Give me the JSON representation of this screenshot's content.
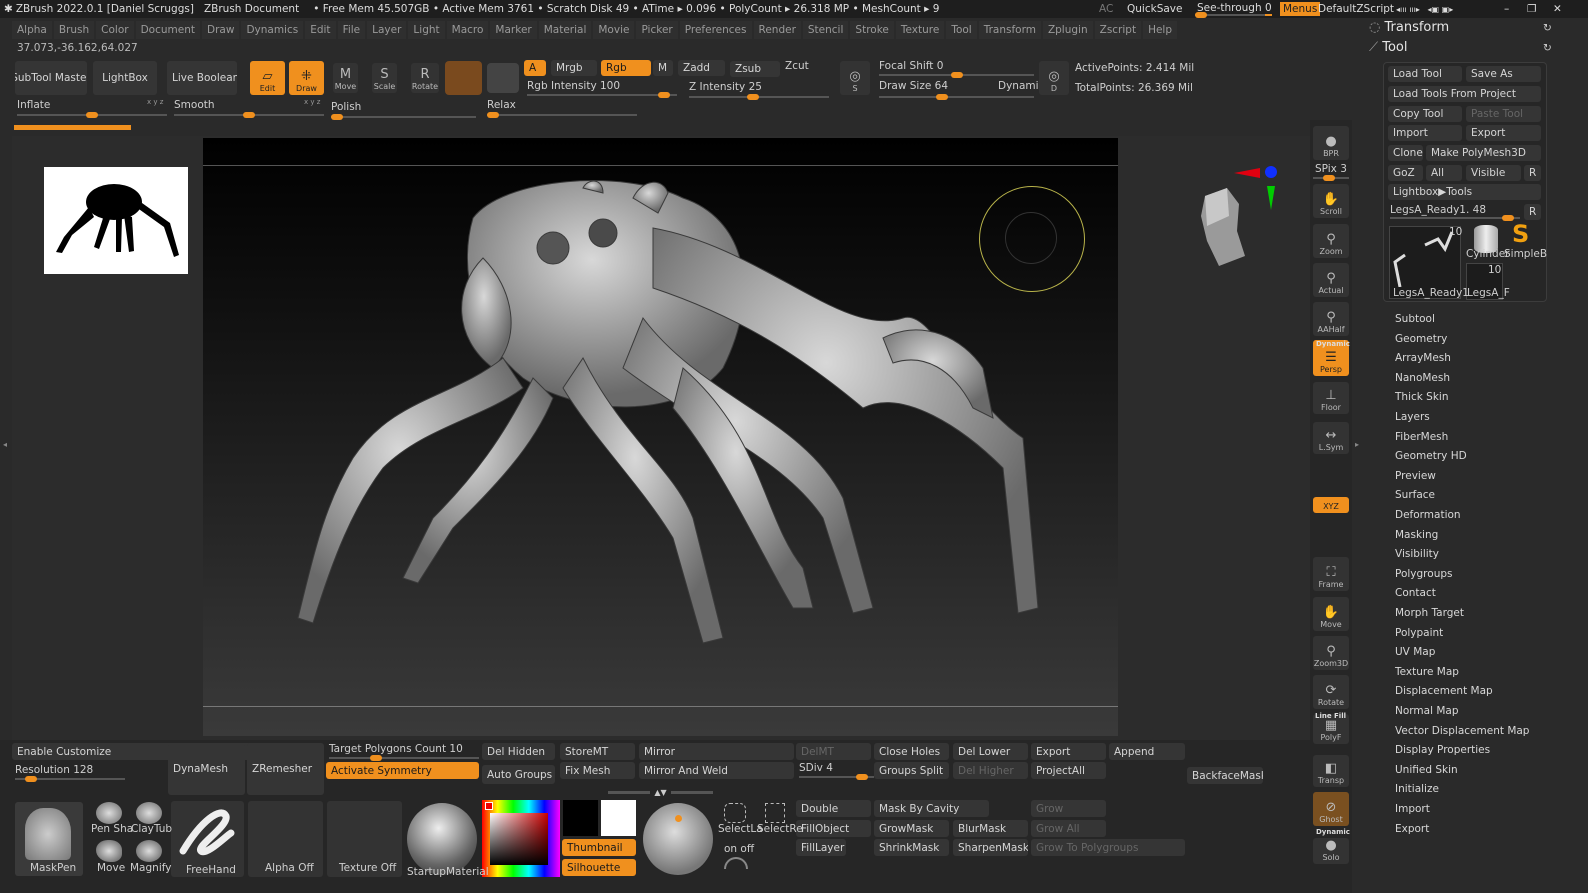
{
  "title": {
    "app": "ZBrush 2022.0.1 [Daniel Scruggs]",
    "doc": "ZBrush Document",
    "stats": "• Free Mem 45.507GB • Active Mem 3761 • Scratch Disk 49 • ATime ▸ 0.096 • PolyCount ▸ 26.318 MP • MeshCount ▸ 9",
    "ac": "AC",
    "quicksave": "QuickSave",
    "seethrough": "See-through  0",
    "menus": "Menus",
    "script": "DefaultZScript"
  },
  "menu": [
    "Alpha",
    "Brush",
    "Color",
    "Document",
    "Draw",
    "Dynamics",
    "Edit",
    "File",
    "Layer",
    "Light",
    "Macro",
    "Marker",
    "Material",
    "Movie",
    "Picker",
    "Preferences",
    "Render",
    "Stencil",
    "Stroke",
    "Texture",
    "Tool",
    "Transform",
    "Zplugin",
    "Zscript",
    "Help"
  ],
  "coords": "37.073,-36.162,64.027",
  "toolbar": {
    "subtool_master": "SubTool Master",
    "lightbox": "LightBox",
    "live_boolean": "Live Boolean",
    "edit": "Edit",
    "draw": "Draw",
    "move": "Move",
    "scale": "Scale",
    "rotate": "Rotate",
    "a": "A",
    "mrgb": "Mrgb",
    "rgb": "Rgb",
    "m": "M",
    "zadd": "Zadd",
    "zsub": "Zsub",
    "zcut": "Zcut",
    "rgb_intensity": "Rgb Intensity 100",
    "z_intensity": "Z Intensity 25",
    "focal_shift": "Focal Shift 0",
    "draw_size": "Draw Size 64",
    "dynamic": "Dynamic",
    "active_points": "ActivePoints: 2.414 Mil",
    "total_points": "TotalPoints: 26.369 Mil",
    "s": "S",
    "d": "D"
  },
  "sliders": {
    "inflate": "Inflate",
    "smooth": "Smooth",
    "polish": "Polish",
    "relax": "Relax",
    "xyz": "x y z"
  },
  "panel": {
    "transform": "Transform",
    "tool": "Tool",
    "load_tool": "Load Tool",
    "save_as": "Save As",
    "load_from_project": "Load Tools From Project",
    "copy_tool": "Copy Tool",
    "paste_tool": "Paste Tool",
    "import": "Import",
    "export": "Export",
    "clone": "Clone",
    "make_polymesh": "Make PolyMesh3D",
    "goz": "GoZ",
    "all": "All",
    "visible": "Visible",
    "r": "R",
    "lightbox_tools": "Lightbox▶Tools",
    "current_tool": "LegsA_Ready1. 48",
    "thumb1": "LegsA_Ready1",
    "thumb1_count": "10",
    "thumb2": "Cylinder",
    "thumb3": "SimpleB",
    "thumb4": "LegsA_F",
    "thumb4_count": "10"
  },
  "subpalettes": [
    "Subtool",
    "Geometry",
    "ArrayMesh",
    "NanoMesh",
    "Thick Skin",
    "Layers",
    "FiberMesh",
    "Geometry HD",
    "Preview",
    "Surface",
    "Deformation",
    "Masking",
    "Visibility",
    "Polygroups",
    "Contact",
    "Morph Target",
    "Polypaint",
    "UV Map",
    "Texture Map",
    "Displacement Map",
    "Normal Map",
    "Vector Displacement Map",
    "Display Properties",
    "Unified Skin",
    "Initialize",
    "Import",
    "Export"
  ],
  "rightshelf": {
    "bpr": "BPR",
    "spix": "SPix 3",
    "scroll": "Scroll",
    "zoom": "Zoom",
    "actual": "Actual",
    "aahalf": "AAHalf",
    "dynamic": "Dynamic",
    "persp": "Persp",
    "floor": "Floor",
    "lsym": "L.Sym",
    "xyz": "XYZ",
    "frame": "Frame",
    "move": "Move",
    "zoom3d": "Zoom3D",
    "rotate": "Rotate",
    "linefill": "Line Fill",
    "polyf": "PolyF",
    "transp": "Transp",
    "ghost": "Ghost",
    "dynamic2": "Dynamic",
    "solo": "Solo"
  },
  "bottom": {
    "enable_customize": "Enable Customize",
    "resolution": "Resolution 128",
    "dynamesh": "DynaMesh",
    "zremesher": "ZRemesher",
    "target_polys": "Target Polygons Count 10",
    "activate_symmetry": "Activate Symmetry",
    "del_hidden": "Del Hidden",
    "auto_groups": "Auto Groups",
    "storemt": "StoreMT",
    "fix_mesh": "Fix Mesh",
    "mirror": "Mirror",
    "mirror_weld": "Mirror And Weld",
    "delmt": "DelMT",
    "sdiv": "SDiv 4",
    "close_holes": "Close Holes",
    "groups_split": "Groups Split",
    "del_lower": "Del Lower",
    "del_higher": "Del Higher",
    "export": "Export",
    "project_all": "ProjectAll",
    "append": "Append",
    "backface_mask": "BackfaceMask",
    "double": "Double",
    "fill_object": "FillObject",
    "fill_layer": "FillLayer",
    "mask_by_cavity": "Mask By Cavity",
    "grow_mask": "GrowMask",
    "shrink_mask": "ShrinkMask",
    "blur_mask": "BlurMask",
    "sharpen_mask": "SharpenMask",
    "grow": "Grow",
    "grow_all": "Grow All",
    "grow_to_polygroups": "Grow To Polygroups",
    "maskpen": "MaskPen",
    "pen_sha": "Pen Sha",
    "claytub": "ClayTub",
    "move": "Move",
    "magnify": "Magnify",
    "freehand": "FreeHand",
    "alpha_off": "Alpha Off",
    "texture_off": "Texture Off",
    "startup_material": "StartupMaterial",
    "thumbnail": "Thumbnail",
    "silhouette": "Silhouette",
    "select_lasso": "SelectLa",
    "select_rect": "SelectRe",
    "on_off": "on  off"
  },
  "colors": {
    "accent": "#f0901e",
    "bg": "#2a2a2a",
    "button": "#353535"
  }
}
